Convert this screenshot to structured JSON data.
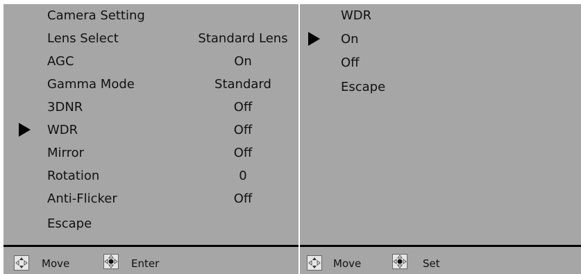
{
  "left_menu": {
    "title": "Camera Setting",
    "items": [
      {
        "label": "Lens Select",
        "value": "Standard Lens"
      },
      {
        "label": "AGC",
        "value": "On"
      },
      {
        "label": "Gamma Mode",
        "value": "Standard"
      },
      {
        "label": "3DNR",
        "value": "Off"
      },
      {
        "label": "WDR",
        "value": "Off",
        "selected": true
      },
      {
        "label": "Mirror",
        "value": "Off"
      },
      {
        "label": "Rotation",
        "value": "0"
      },
      {
        "label": "Anti-Flicker",
        "value": "Off"
      }
    ],
    "escape": "Escape",
    "footer": {
      "move_label": "Move",
      "move_icon": "dpad-move-icon",
      "action_label": "Enter",
      "action_icon": "dpad-center-icon"
    }
  },
  "right_menu": {
    "title": "WDR",
    "options": [
      {
        "label": "On",
        "selected": true
      },
      {
        "label": "Off"
      }
    ],
    "escape": "Escape",
    "footer": {
      "move_label": "Move",
      "move_icon": "dpad-move-icon",
      "action_label": "Set",
      "action_icon": "dpad-center-icon"
    }
  },
  "colors": {
    "panel_bg": "#a6a6a6",
    "text": "#111111",
    "accent": "#000000"
  }
}
